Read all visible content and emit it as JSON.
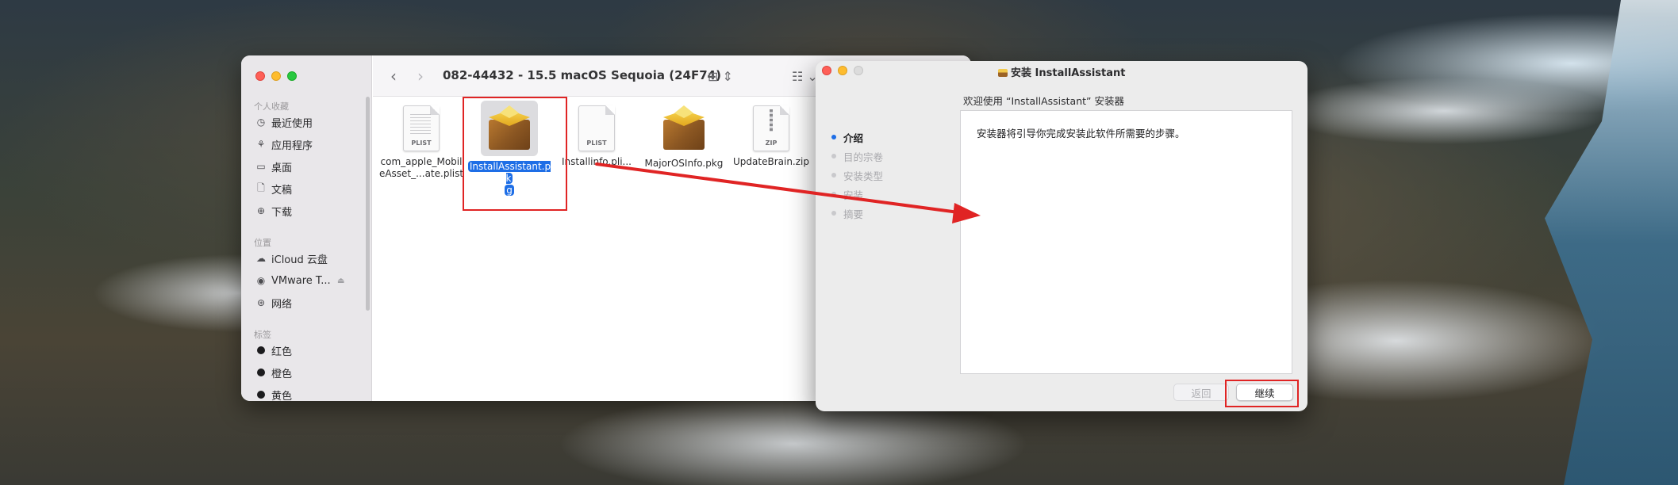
{
  "finder": {
    "title": "082-44432 - 15.5 macOS Sequoia (24F74)",
    "sidebar": {
      "favorites_header": "个人收藏",
      "favorites": [
        {
          "label": "最近使用",
          "icon": "clock-icon"
        },
        {
          "label": "应用程序",
          "icon": "apps-icon"
        },
        {
          "label": "桌面",
          "icon": "desktop-icon"
        },
        {
          "label": "文稿",
          "icon": "document-icon"
        },
        {
          "label": "下载",
          "icon": "download-icon"
        }
      ],
      "locations_header": "位置",
      "locations": [
        {
          "label": "iCloud 云盘",
          "icon": "cloud-icon"
        },
        {
          "label": "VMware T...",
          "icon": "disk-icon"
        },
        {
          "label": "网络",
          "icon": "globe-icon"
        }
      ],
      "tags_header": "标签",
      "tags": [
        {
          "label": "红色"
        },
        {
          "label": "橙色"
        },
        {
          "label": "黄色"
        }
      ]
    },
    "files": [
      {
        "name": "com_apple_MobileAsset_...ate.plist",
        "line1": "com_apple_Mobil",
        "line2": "eAsset_...ate.plist",
        "type": "PLIST"
      },
      {
        "name": "InstallAssistant.pkg",
        "line1": "InstallAssistant.pk",
        "line2": "g",
        "type": "pkg",
        "selected": true
      },
      {
        "name": "Installinfo.plist",
        "line1": "Installinfo.pli...",
        "type": "PLIST"
      },
      {
        "name": "MajorOSInfo.pkg",
        "line1": "MajorOSInfo.pkg",
        "type": "pkg"
      },
      {
        "name": "UpdateBrain.zip",
        "line1": "UpdateBrain.zip",
        "type": "ZIP"
      }
    ]
  },
  "installer": {
    "title": "安装 InstallAssistant",
    "heading": "欢迎使用 “InstallAssistant” 安装器",
    "steps": [
      {
        "label": "介绍",
        "active": true
      },
      {
        "label": "目的宗卷"
      },
      {
        "label": "安装类型"
      },
      {
        "label": "安装"
      },
      {
        "label": "摘要"
      }
    ],
    "message": "安装器将引导你完成安装此软件所需要的步骤。",
    "back_label": "返回",
    "continue_label": "继续"
  },
  "colors": {
    "selection": "#1e6ee6",
    "annotation": "#e02424"
  }
}
